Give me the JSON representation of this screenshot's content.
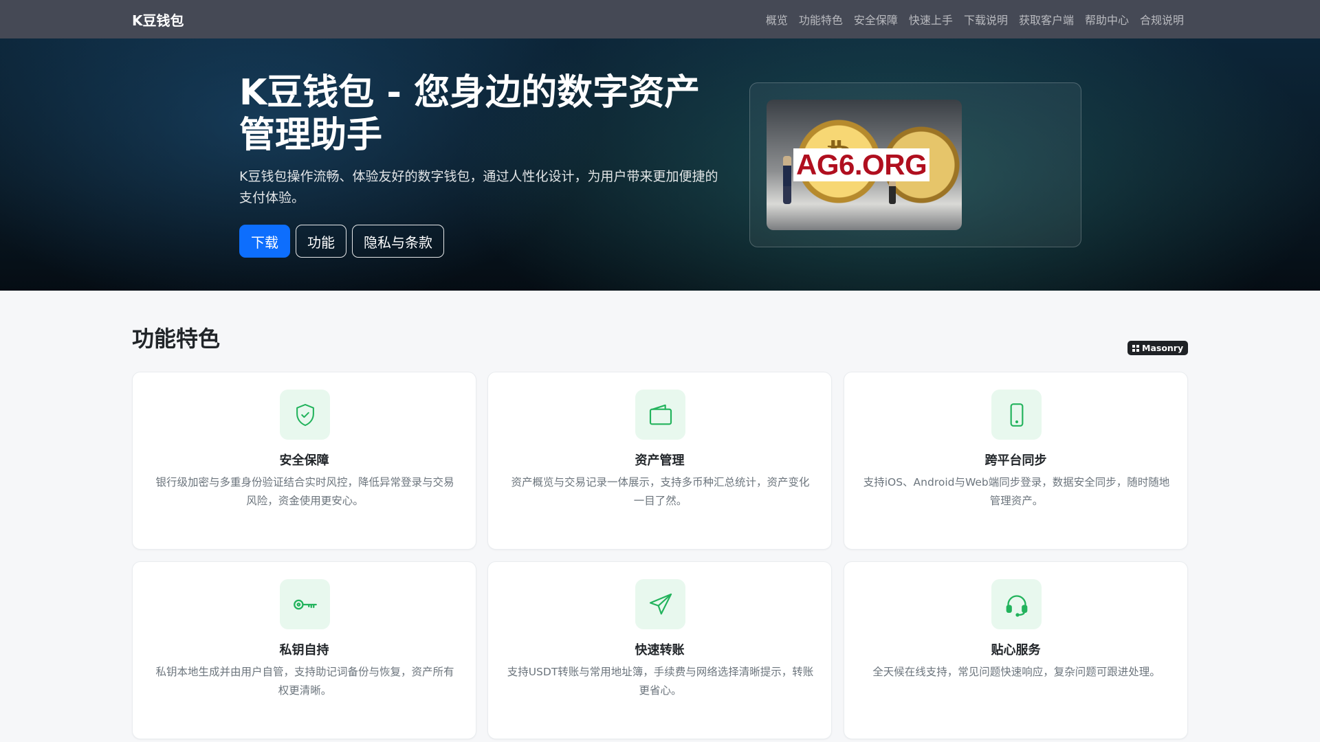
{
  "nav": {
    "brand": "K豆钱包",
    "links": [
      "概览",
      "功能特色",
      "安全保障",
      "快速上手",
      "下载说明",
      "获取客户端",
      "帮助中心",
      "合规说明"
    ]
  },
  "hero": {
    "title": "K豆钱包 - 您身边的数字资产管理助手",
    "description": "K豆钱包操作流畅、体验友好的数字钱包，通过人性化设计，为用户带来更加便捷的支付体验。",
    "buttons": {
      "download": "下载",
      "features": "功能",
      "privacy": "隐私与条款"
    },
    "image_badge": "AG6.ORG"
  },
  "features": {
    "title": "功能特色",
    "layout_badge": "Masonry",
    "items": [
      {
        "icon": "shield-check-icon",
        "title": "安全保障",
        "text": "银行级加密与多重身份验证结合实时风控，降低异常登录与交易风险，资金使用更安心。"
      },
      {
        "icon": "wallet-icon",
        "title": "资产管理",
        "text": "资产概览与交易记录一体展示，支持多币种汇总统计，资产变化一目了然。"
      },
      {
        "icon": "tablet-icon",
        "title": "跨平台同步",
        "text": "支持iOS、Android与Web端同步登录，数据安全同步，随时随地管理资产。"
      },
      {
        "icon": "key-icon",
        "title": "私钥自持",
        "text": "私钥本地生成并由用户自管，支持助记词备份与恢复，资产所有权更清晰。"
      },
      {
        "icon": "send-icon",
        "title": "快速转账",
        "text": "支持USDT转账与常用地址簿，手续费与网络选择清晰提示，转账更省心。"
      },
      {
        "icon": "headset-icon",
        "title": "贴心服务",
        "text": "全天候在线支持，常见问题快速响应，复杂问题可跟进处理。"
      }
    ]
  },
  "colors": {
    "accent_green": "#22b35c",
    "primary_blue": "#0d6efd",
    "navbar_bg": "#454955"
  }
}
